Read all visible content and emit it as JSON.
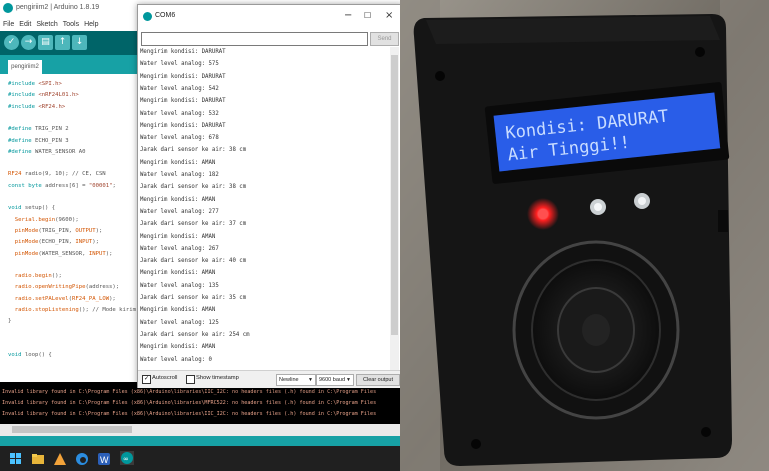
{
  "ide": {
    "title": "pengiriim2 | Arduino 1.8.19",
    "menu": [
      "File",
      "Edit",
      "Sketch",
      "Tools",
      "Help"
    ],
    "tab_label": "pengiriim2",
    "code": [
      {
        "text": "#include <SPI.h>"
      },
      {
        "text": "#include <nRF24L01.h>"
      },
      {
        "text": "#include <RF24.h>"
      },
      {
        "text": ""
      },
      {
        "text": "#define TRIG_PIN 2"
      },
      {
        "text": "#define ECHO_PIN 3"
      },
      {
        "text": "#define WATER_SENSOR A0"
      },
      {
        "text": ""
      },
      {
        "text": "RF24 radio(9, 10); // CE, CSN"
      },
      {
        "text": "const byte address[6] = \"00001\";"
      },
      {
        "text": ""
      },
      {
        "text": "void setup() {"
      },
      {
        "text": "  Serial.begin(9600);"
      },
      {
        "text": "  pinMode(TRIG_PIN, OUTPUT);"
      },
      {
        "text": "  pinMode(ECHO_PIN, INPUT);"
      },
      {
        "text": "  pinMode(WATER_SENSOR, INPUT);"
      },
      {
        "text": ""
      },
      {
        "text": "  radio.begin();"
      },
      {
        "text": "  radio.openWritingPipe(address);"
      },
      {
        "text": "  radio.setPALevel(RF24_PA_LOW);"
      },
      {
        "text": "  radio.stopListening(); // Mode kirim"
      },
      {
        "text": "}"
      },
      {
        "text": ""
      },
      {
        "text": ""
      },
      {
        "text": "void loop() {"
      }
    ],
    "console": [
      "Invalid library found in C:\\Program Files (x86)\\Arduino\\libraries\\IIC_I2C: no headers files (.h) found in C:\\Program Files",
      "Invalid library found in C:\\Program Files (x86)\\Arduino\\libraries\\MFRC522: no headers files (.h) found in C:\\Program Files",
      "Invalid library found in C:\\Program Files (x86)\\Arduino\\libraries\\IIC_I2C: no headers files (.h) found in C:\\Program Files"
    ]
  },
  "serial": {
    "title": "COM6",
    "send_label": "Send",
    "lines": [
      "Mengirim kondisi: DARURAT",
      "Water level analog: 575",
      "Mengirim kondisi: DARURAT",
      "Water level analog: 542",
      "Mengirim kondisi: DARURAT",
      "Water level analog: 532",
      "Mengirim kondisi: DARURAT",
      "Water level analog: 678",
      "Jarak dari sensor ke air: 38 cm",
      "Mengirim kondisi: AMAN",
      "Water level analog: 182",
      "Jarak dari sensor ke air: 38 cm",
      "Mengirim kondisi: AMAN",
      "Water level analog: 277",
      "Jarak dari sensor ke air: 37 cm",
      "Mengirim kondisi: AMAN",
      "Water level analog: 267",
      "Jarak dari sensor ke air: 40 cm",
      "Mengirim kondisi: AMAN",
      "Water level analog: 135",
      "Jarak dari sensor ke air: 35 cm",
      "Mengirim kondisi: AMAN",
      "Water level analog: 125",
      "Jarak dari sensor ke air: 254 cm",
      "Mengirim kondisi: AMAN",
      "Water level analog: 0"
    ],
    "autoscroll_label": "Autoscroll",
    "timestamp_label": "Show timestamp",
    "line_ending": "Newline",
    "baud": "9600 baud",
    "clear_label": "Clear output"
  },
  "photo": {
    "lcd_line1": "Kondisi: DARURAT",
    "lcd_line2": "Air Tinggi!!",
    "colors": {
      "lcd_bg": "#1d4fe0",
      "lcd_text": "#c8dcff",
      "led_red": "#ff2020",
      "case": "#151515"
    }
  }
}
